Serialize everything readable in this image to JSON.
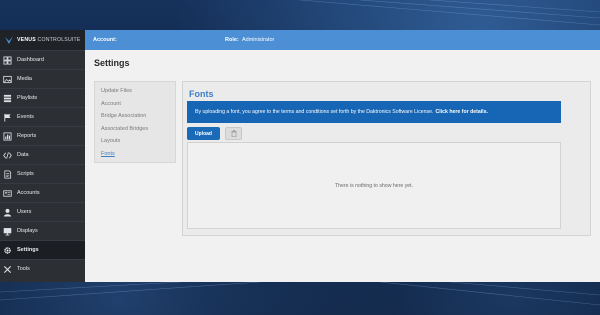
{
  "brand": {
    "bold": "VENUS",
    "light": "CONTROL",
    "rest": "SUITE"
  },
  "sidebar": {
    "items": [
      {
        "label": "Dashboard",
        "icon": "dashboard-icon"
      },
      {
        "label": "Media",
        "icon": "image-icon"
      },
      {
        "label": "Playlists",
        "icon": "playlist-icon"
      },
      {
        "label": "Events",
        "icon": "flag-icon"
      },
      {
        "label": "Reports",
        "icon": "reports-icon"
      },
      {
        "label": "Data",
        "icon": "code-icon"
      },
      {
        "label": "Scripts",
        "icon": "scripts-icon"
      },
      {
        "label": "Accounts",
        "icon": "accounts-icon"
      },
      {
        "label": "Users",
        "icon": "user-icon"
      },
      {
        "label": "Displays",
        "icon": "monitor-icon"
      },
      {
        "label": "Settings",
        "icon": "gear-icon",
        "active": true
      },
      {
        "label": "Tools",
        "icon": "tools-icon"
      }
    ]
  },
  "topbar": {
    "account_label": "Account:",
    "role_label": "Role:",
    "role_value": "Administrator"
  },
  "page": {
    "title": "Settings"
  },
  "subnav": {
    "items": [
      "Update Files",
      "Account",
      "Bridge Association",
      "Associated Bridges",
      "Layouts",
      "Fonts"
    ],
    "active": "Fonts"
  },
  "fonts": {
    "title": "Fonts",
    "notice_text": "By uploading a font, you agree to the terms and conditions set forth by the Daktronics Software License.",
    "notice_link": "Click here for details.",
    "upload_label": "Upload",
    "empty_text": "There is nothing to show here yet."
  },
  "colors": {
    "accent": "#1766b5",
    "topbar": "#4d8fd4",
    "sidebar": "#2c3035",
    "link": "#3e7fc4"
  }
}
